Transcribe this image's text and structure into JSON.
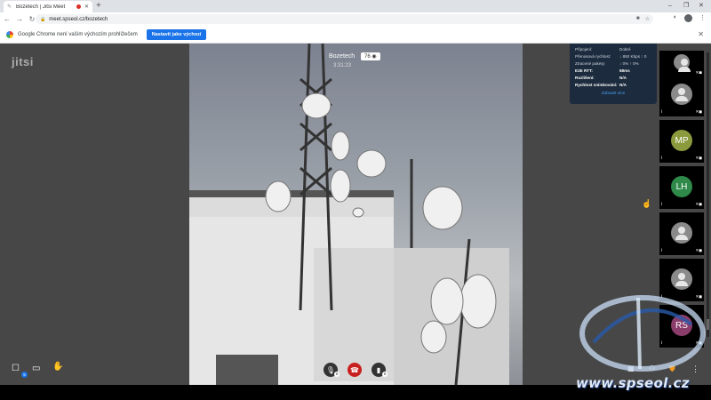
{
  "browser": {
    "tab_title": "Bozetech | Jitsi Meet",
    "new_tab": "+",
    "url": "meet.spseol.cz/bozetech",
    "window_controls": [
      "–",
      "❐",
      "✕"
    ]
  },
  "infobar": {
    "message": "Google Chrome není vaším výchozím prohlížečem",
    "button": "Nastavit jako výchozí",
    "close": "✕"
  },
  "meeting": {
    "logo": "jitsi",
    "title": "Bozetech",
    "participant_count": "76",
    "timer": "3:31:23"
  },
  "stats": {
    "rows": [
      {
        "k": "Připojení:",
        "v": "Dobré"
      },
      {
        "k": "Přenosová rychlost:",
        "v": "↓ 850 Kbps ↑ 0"
      },
      {
        "k": "Ztracené pakety:",
        "v": "↓ 0% ↑ 0%"
      },
      {
        "k": "E2E RTT:",
        "v": "68ms"
      },
      {
        "k": "Rozlišení:",
        "v": "N/A"
      },
      {
        "k": "Rychlost snímkování:",
        "v": "N/A"
      }
    ],
    "more": "Zobrazit více"
  },
  "filmstrip": [
    {
      "initials": "",
      "type": "person"
    },
    {
      "initials": "",
      "type": "person"
    },
    {
      "initials": "MP",
      "type": "initials",
      "color": "#8a9a3c"
    },
    {
      "initials": "LH",
      "type": "initials",
      "color": "#2f8a4a"
    },
    {
      "initials": "",
      "type": "person"
    },
    {
      "initials": "",
      "type": "person"
    },
    {
      "initials": "RS",
      "type": "initials",
      "color": "#8a3c6a"
    }
  ],
  "controls": {
    "chat_badge": "5"
  },
  "watermark": "www.spseol.cz"
}
